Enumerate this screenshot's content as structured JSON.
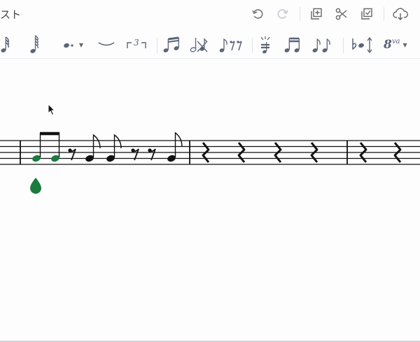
{
  "header": {
    "title": "スト"
  },
  "toolbar": {
    "buttons": [
      {
        "name": "undo-button",
        "icon": "undo-icon"
      },
      {
        "name": "redo-button",
        "icon": "redo-icon"
      },
      {
        "name": "add-measure-button",
        "icon": "add-measure-icon"
      },
      {
        "name": "cut-button",
        "icon": "scissors-icon"
      },
      {
        "name": "check-button",
        "icon": "check-icon"
      },
      {
        "name": "download-button",
        "icon": "cloud-download-icon"
      }
    ]
  },
  "palette": {
    "tuplet_label": "3",
    "ottava_label": "8",
    "ottava_suffix": "va",
    "items": [
      "sixtyfourth-note",
      "hundred-twenty-eighth-note",
      "dotted-note",
      "slur",
      "tuplet",
      "beam-group",
      "half-note-cross",
      "eighth-rest-group",
      "grace-note",
      "beamed-sixteenths",
      "beamed-eighths",
      "flat-accidental",
      "ottava"
    ]
  },
  "colors": {
    "accent_green": "#1b7a3d",
    "icon_gray": "#5a6478",
    "staff_black": "#111111"
  }
}
